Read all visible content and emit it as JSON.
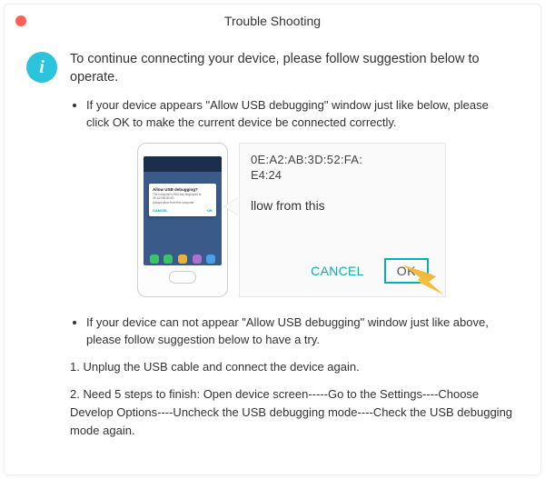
{
  "window": {
    "title": "Trouble Shooting"
  },
  "lead": "To continue connecting your device, please follow suggestion below to operate.",
  "bullets": {
    "b1": "If your device appears \"Allow USB debugging\" window just like below, please click OK to make the current device  be connected correctly.",
    "b2": "If your device can not appear \"Allow USB debugging\" window just like above, please follow suggestion below to have a try."
  },
  "phone_dialog": {
    "title": "Allow USB debugging?",
    "body": "The computer's RSA key fingerprint is: 0E:A2:AB:3D:52:",
    "always": "Always allow from this computer",
    "cancel": "CANCEL",
    "ok": "OK"
  },
  "callout": {
    "line1": "0E:A2:AB:3D:52:FA:",
    "line2": "E4:24",
    "line3": "llow from this",
    "cancel": "CANCEL",
    "ok": "OK"
  },
  "steps": {
    "s1": "1. Unplug the USB cable and connect the device again.",
    "s2": "2. Need 5 steps to finish: Open device screen-----Go to the Settings----Choose Develop Options----Uncheck the USB debugging mode----Check the USB debugging mode again."
  }
}
